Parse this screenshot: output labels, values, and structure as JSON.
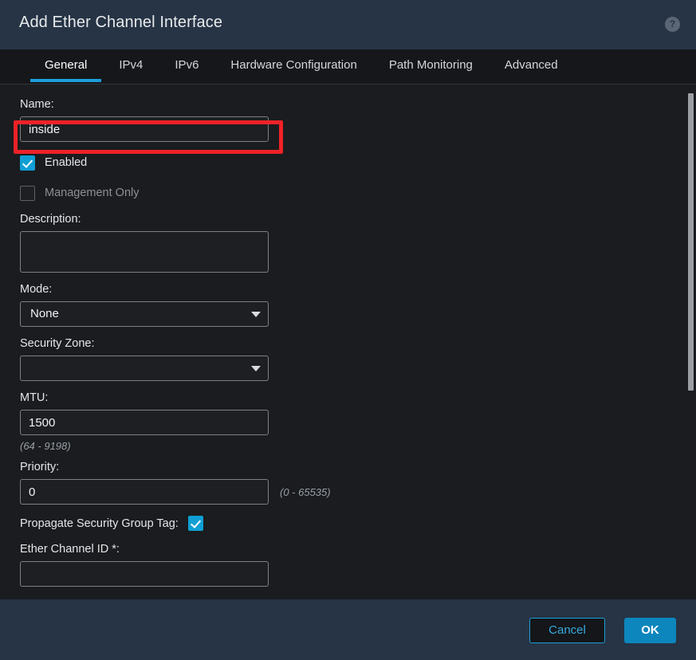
{
  "header": {
    "title": "Add Ether Channel Interface",
    "help_icon": "help-circle-icon",
    "help_glyph": "?"
  },
  "tabs": [
    {
      "label": "General",
      "active": true
    },
    {
      "label": "IPv4",
      "active": false
    },
    {
      "label": "IPv6",
      "active": false
    },
    {
      "label": "Hardware Configuration",
      "active": false
    },
    {
      "label": "Path Monitoring",
      "active": false
    },
    {
      "label": "Advanced",
      "active": false
    }
  ],
  "form": {
    "name": {
      "label": "Name:",
      "value": "inside",
      "placeholder": ""
    },
    "enabled": {
      "label": "Enabled",
      "checked": true
    },
    "management_only": {
      "label": "Management Only",
      "checked": false,
      "disabled": true
    },
    "description": {
      "label": "Description:",
      "value": "",
      "placeholder": ""
    },
    "mode": {
      "label": "Mode:",
      "value": "None",
      "options": [
        "None"
      ]
    },
    "security_zone": {
      "label": "Security Zone:",
      "value": "",
      "options": []
    },
    "mtu": {
      "label": "MTU:",
      "value": "1500",
      "hint": "(64 - 9198)"
    },
    "priority": {
      "label": "Priority:",
      "value": "0",
      "hint": "(0 - 65535)"
    },
    "propagate_sgt": {
      "label": "Propagate Security Group Tag:",
      "checked": true
    },
    "ether_channel_id": {
      "label": "Ether Channel ID *:",
      "value": "",
      "placeholder": ""
    }
  },
  "footer": {
    "cancel_label": "Cancel",
    "ok_label": "OK"
  },
  "colors": {
    "header_bg": "#263445",
    "body_bg": "#1a1c1f",
    "accent": "#1b9ed9",
    "checkbox_checked": "#109fd4",
    "ok_button": "#0d86bd",
    "annotation": "#ee2228"
  }
}
